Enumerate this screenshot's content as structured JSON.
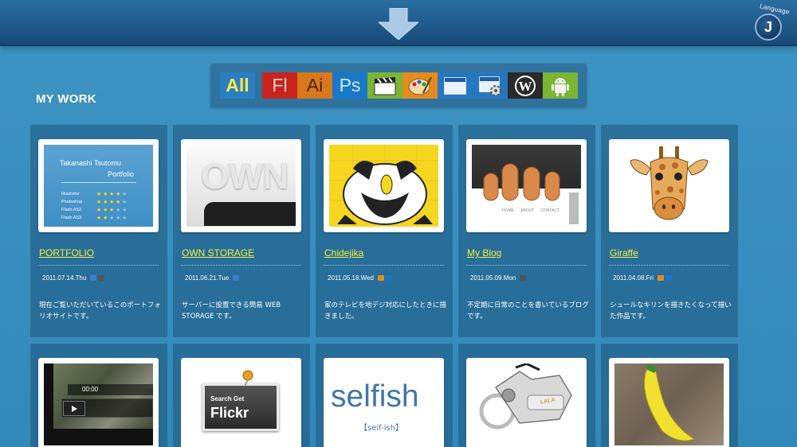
{
  "language": {
    "label": "Language",
    "initial": "J"
  },
  "filters": [
    {
      "label": "All",
      "bg": "#2a7ec4",
      "fg": "#ffe94a"
    },
    {
      "label": "Fl",
      "bg": "#c8241e",
      "fg": "#f7d2c5"
    },
    {
      "label": "Ai",
      "bg": "#d8781a",
      "fg": "#4a2208"
    },
    {
      "label": "Ps",
      "bg": "#1a78c8",
      "fg": "#cfeaff"
    },
    {
      "label": "",
      "icon": "clapperboard-icon",
      "bg": "#7ab534"
    },
    {
      "label": "",
      "icon": "palette-icon",
      "bg": "#e58b1d"
    },
    {
      "label": "",
      "icon": "browser-window-icon",
      "bg": "#2677c2"
    },
    {
      "label": "",
      "icon": "browser-gear-icon",
      "bg": "#2677c2"
    },
    {
      "label": "",
      "icon": "wordpress-icon",
      "bg": "#2a2a2a"
    },
    {
      "label": "",
      "icon": "android-icon",
      "bg": "#7ab534"
    }
  ],
  "section_title": "MY WORK",
  "works": [
    {
      "title": "PORTFOLIO",
      "date": "2011.07.14.Thu",
      "desc": "現在ご覧いただいているこのポートフォリオサイトです。",
      "tags": [
        "#3a7fc8",
        "#555555"
      ],
      "thumb": {
        "heading1": "Takanashi Tsutomu",
        "heading2": "Portfolio",
        "skills": [
          {
            "name": "Illustrator",
            "stars": 4
          },
          {
            "name": "Photoshop",
            "stars": 4
          },
          {
            "name": "Flash AS2",
            "stars": 3
          },
          {
            "name": "Flash AS3",
            "stars": 2
          }
        ]
      }
    },
    {
      "title": "OWN STORAGE",
      "date": "2011.06.21.Tue",
      "desc": "サーバーに設置できる簡易 WEB STORAGE です。",
      "tags": [
        "#3a7fc8"
      ],
      "thumb": {
        "text": "OWN"
      }
    },
    {
      "title": "Chidejika",
      "date": "2011.05.18.Wed",
      "desc": "家のテレビを地デジ対応にしたときに描きました。",
      "tags": [
        "#e58b1d",
        "#1a78c8"
      ],
      "thumb": {}
    },
    {
      "title": "My Blog",
      "date": "2011.05.09.Mon",
      "desc": "不定期に日常のことを書いているブログです。",
      "tags": [
        "#555555"
      ],
      "thumb": {
        "nav": [
          "HOME",
          "ABOUT",
          "CONTACT"
        ]
      }
    },
    {
      "title": "Giraffe",
      "date": "2011.04.08.Fri",
      "desc": "シュールなキリンを描きたくなって描いた作品です。",
      "tags": [
        "#e58b1d",
        "#1a78c8"
      ],
      "thumb": {}
    }
  ],
  "works_row2": [
    {
      "thumb": {
        "time": "00:00"
      }
    },
    {
      "thumb": {
        "line1": "Search Get",
        "line2": "Flickr"
      }
    },
    {
      "thumb": {
        "word": "selfish",
        "sub": "【seif-ish】"
      }
    },
    {
      "thumb": {
        "badge": "LALA"
      }
    },
    {
      "thumb": {}
    }
  ]
}
